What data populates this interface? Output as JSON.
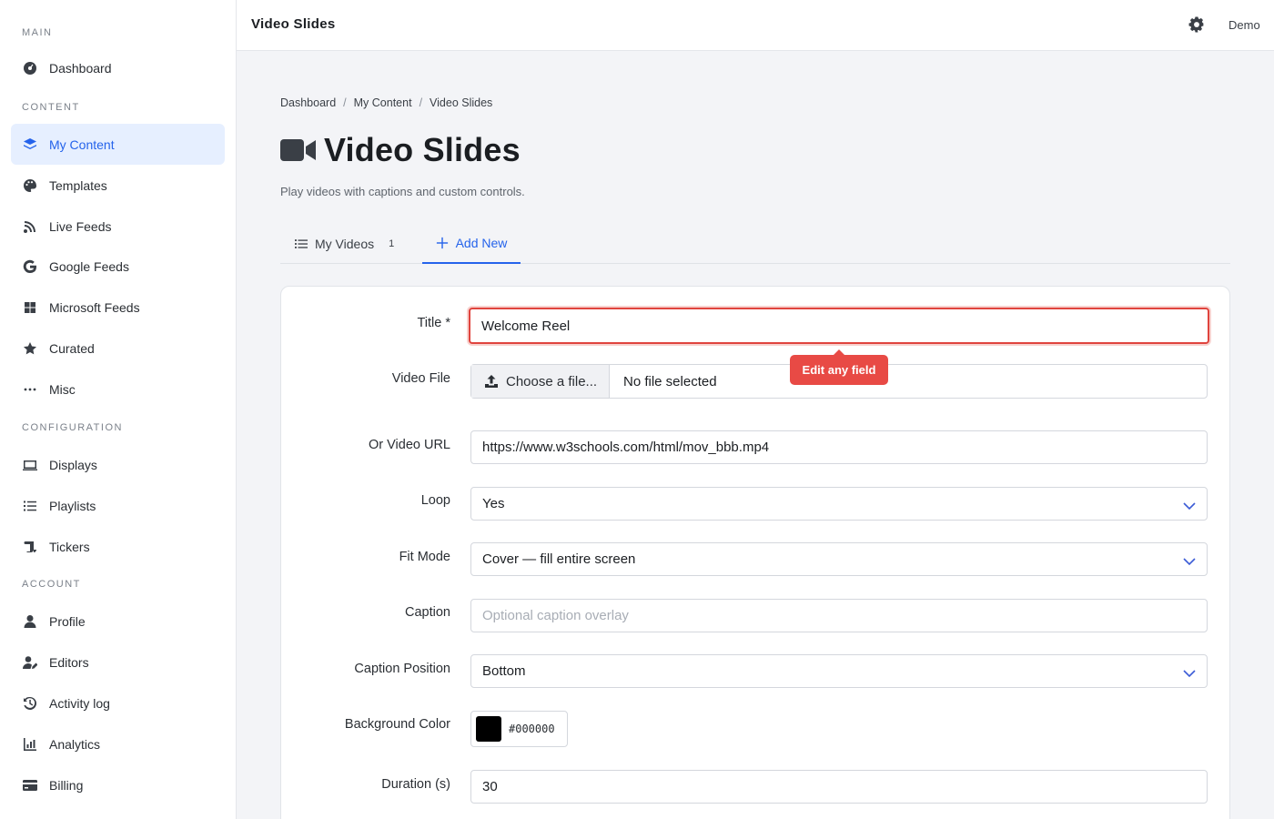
{
  "sidebar": {
    "sections": {
      "main": "MAIN",
      "content": "CONTENT",
      "configuration": "CONFIGURATION",
      "account": "ACCOUNT"
    },
    "items": {
      "dashboard": "Dashboard",
      "my_content": "My Content",
      "templates": "Templates",
      "live_feeds": "Live Feeds",
      "google_feeds": "Google Feeds",
      "microsoft_feeds": "Microsoft Feeds",
      "curated": "Curated",
      "misc": "Misc",
      "displays": "Displays",
      "playlists": "Playlists",
      "tickers": "Tickers",
      "profile": "Profile",
      "editors": "Editors",
      "activity_log": "Activity log",
      "analytics": "Analytics",
      "billing": "Billing"
    },
    "active_item": "my_content"
  },
  "header": {
    "title": "Video Slides",
    "user": "Demo",
    "icons": [
      "gear-icon"
    ]
  },
  "breadcrumb": {
    "items": [
      "Dashboard",
      "My Content",
      "Video Slides"
    ],
    "separator": "/"
  },
  "page": {
    "title": "Video Slides",
    "subtitle": "Play videos with captions and custom controls."
  },
  "tabs": {
    "my_videos": "My Videos",
    "my_videos_count": "1",
    "add_new": "Add New",
    "active": "add_new"
  },
  "form": {
    "title": {
      "label": "Title *",
      "value": "Welcome Reel"
    },
    "video_file": {
      "label": "Video File",
      "button": "Choose a file...",
      "status": "No file selected"
    },
    "video_url": {
      "label": "Or Video URL",
      "value": "https://www.w3schools.com/html/mov_bbb.mp4"
    },
    "loop": {
      "label": "Loop",
      "value": "Yes"
    },
    "fit_mode": {
      "label": "Fit Mode",
      "value": "Cover — fill entire screen"
    },
    "caption": {
      "label": "Caption",
      "placeholder": "Optional caption overlay",
      "value": ""
    },
    "caption_position": {
      "label": "Caption Position",
      "value": "Bottom"
    },
    "background_color": {
      "label": "Background Color",
      "value": "#000000"
    },
    "duration": {
      "label": "Duration (s)",
      "value": "30"
    }
  },
  "tooltip": {
    "text": "Edit any field"
  },
  "colors": {
    "accent": "#2563eb",
    "active_bg": "#e6efff",
    "error": "#e0443e",
    "tooltip_bg": "#e84a45",
    "swatch": "#000000"
  }
}
